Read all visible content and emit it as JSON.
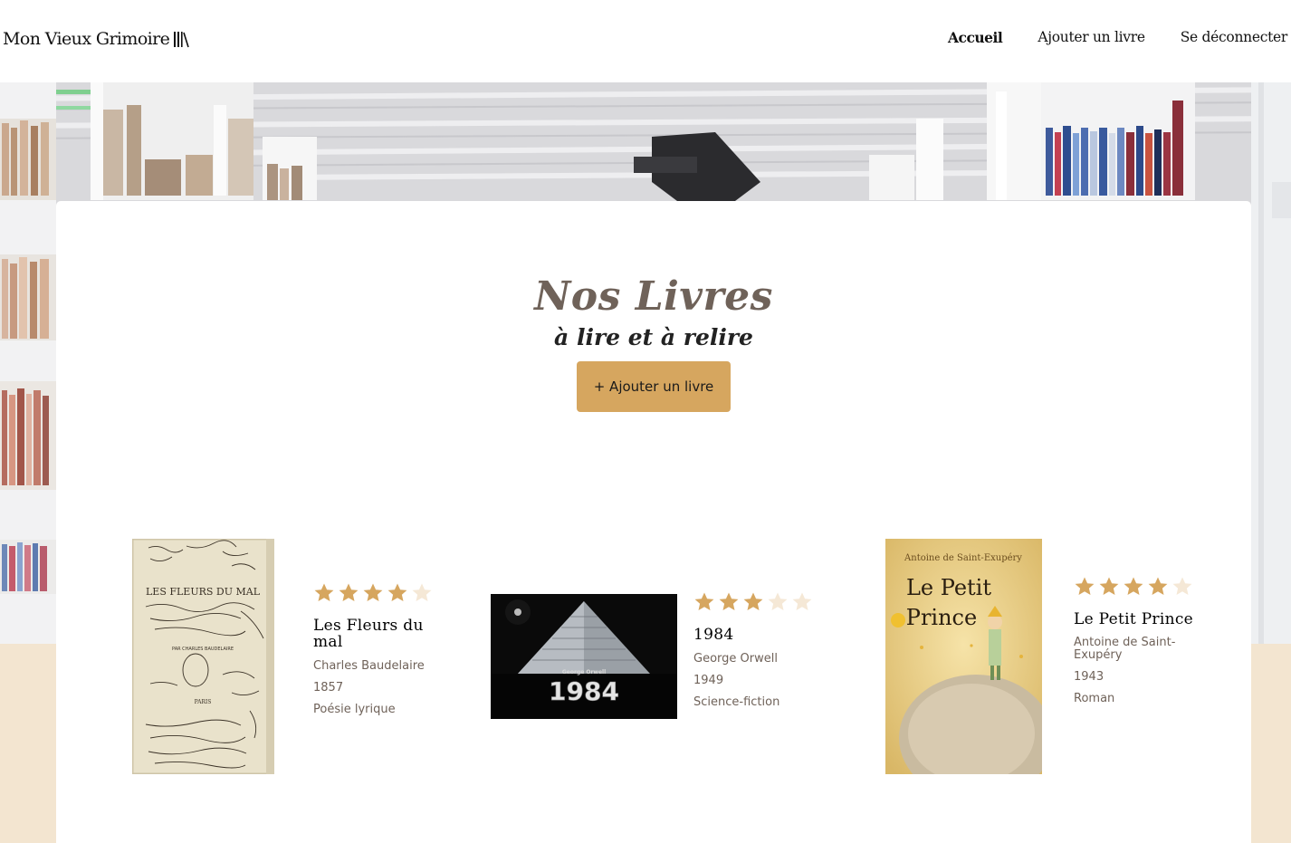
{
  "header": {
    "logo_text": "Mon Vieux Grimoire",
    "nav": [
      "Accueil",
      "Ajouter un livre",
      "Se déconnecter"
    ]
  },
  "main": {
    "title": "Nos Livres",
    "subtitle": "à lire et à relire",
    "add_button_label": "+ Ajouter un livre"
  },
  "books": [
    {
      "title": "Les Fleurs du mal",
      "author": "Charles Baudelaire",
      "year": "1857",
      "genre": "Poésie lyrique",
      "rating": 4,
      "max_rating": 5,
      "cover_text": "LES FLEURS DU MAL"
    },
    {
      "title": "1984",
      "author": "George Orwell",
      "year": "1949",
      "genre": "Science-fiction",
      "rating": 3,
      "max_rating": 5,
      "cover_text": "1984",
      "cover_author": "George Orwell"
    },
    {
      "title": "Le Petit Prince",
      "author": "Antoine de Saint-Exupéry",
      "year": "1943",
      "genre": "Roman",
      "rating": 4,
      "max_rating": 5,
      "cover_text": "Le Petit Prince",
      "cover_author": "Antoine de Saint-Exupéry"
    }
  ],
  "colors": {
    "accent": "#d6a65f",
    "star_filled": "#d6a65f",
    "star_empty": "#f5e8d6",
    "beige_band": "#f3e5d0",
    "title_color": "#6f6259"
  },
  "icons": {
    "logo_mark": "books-icon",
    "rating": "star-icon"
  }
}
